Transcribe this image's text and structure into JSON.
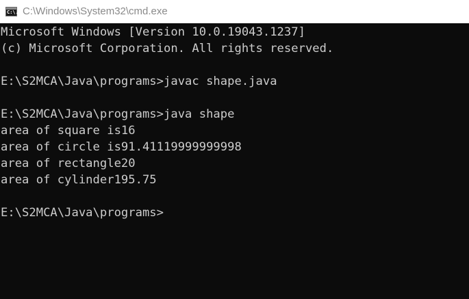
{
  "window": {
    "title": "C:\\Windows\\System32\\cmd.exe",
    "icon": "cmd-icon",
    "icon_glyph": "C:\\."
  },
  "console": {
    "lines": [
      "Microsoft Windows [Version 10.0.19043.1237]",
      "(c) Microsoft Corporation. All rights reserved.",
      "",
      "E:\\S2MCA\\Java\\programs>javac shape.java",
      "",
      "E:\\S2MCA\\Java\\programs>java shape",
      "area of square is16",
      "area of circle is91.41119999999998",
      "area of rectangle20",
      "area of cylinder195.75",
      "",
      "E:\\S2MCA\\Java\\programs>"
    ]
  },
  "colors": {
    "background": "#0c0c0c",
    "text": "#cccccc",
    "titlebar": "#ffffff",
    "title_text": "#8a8a8a"
  }
}
